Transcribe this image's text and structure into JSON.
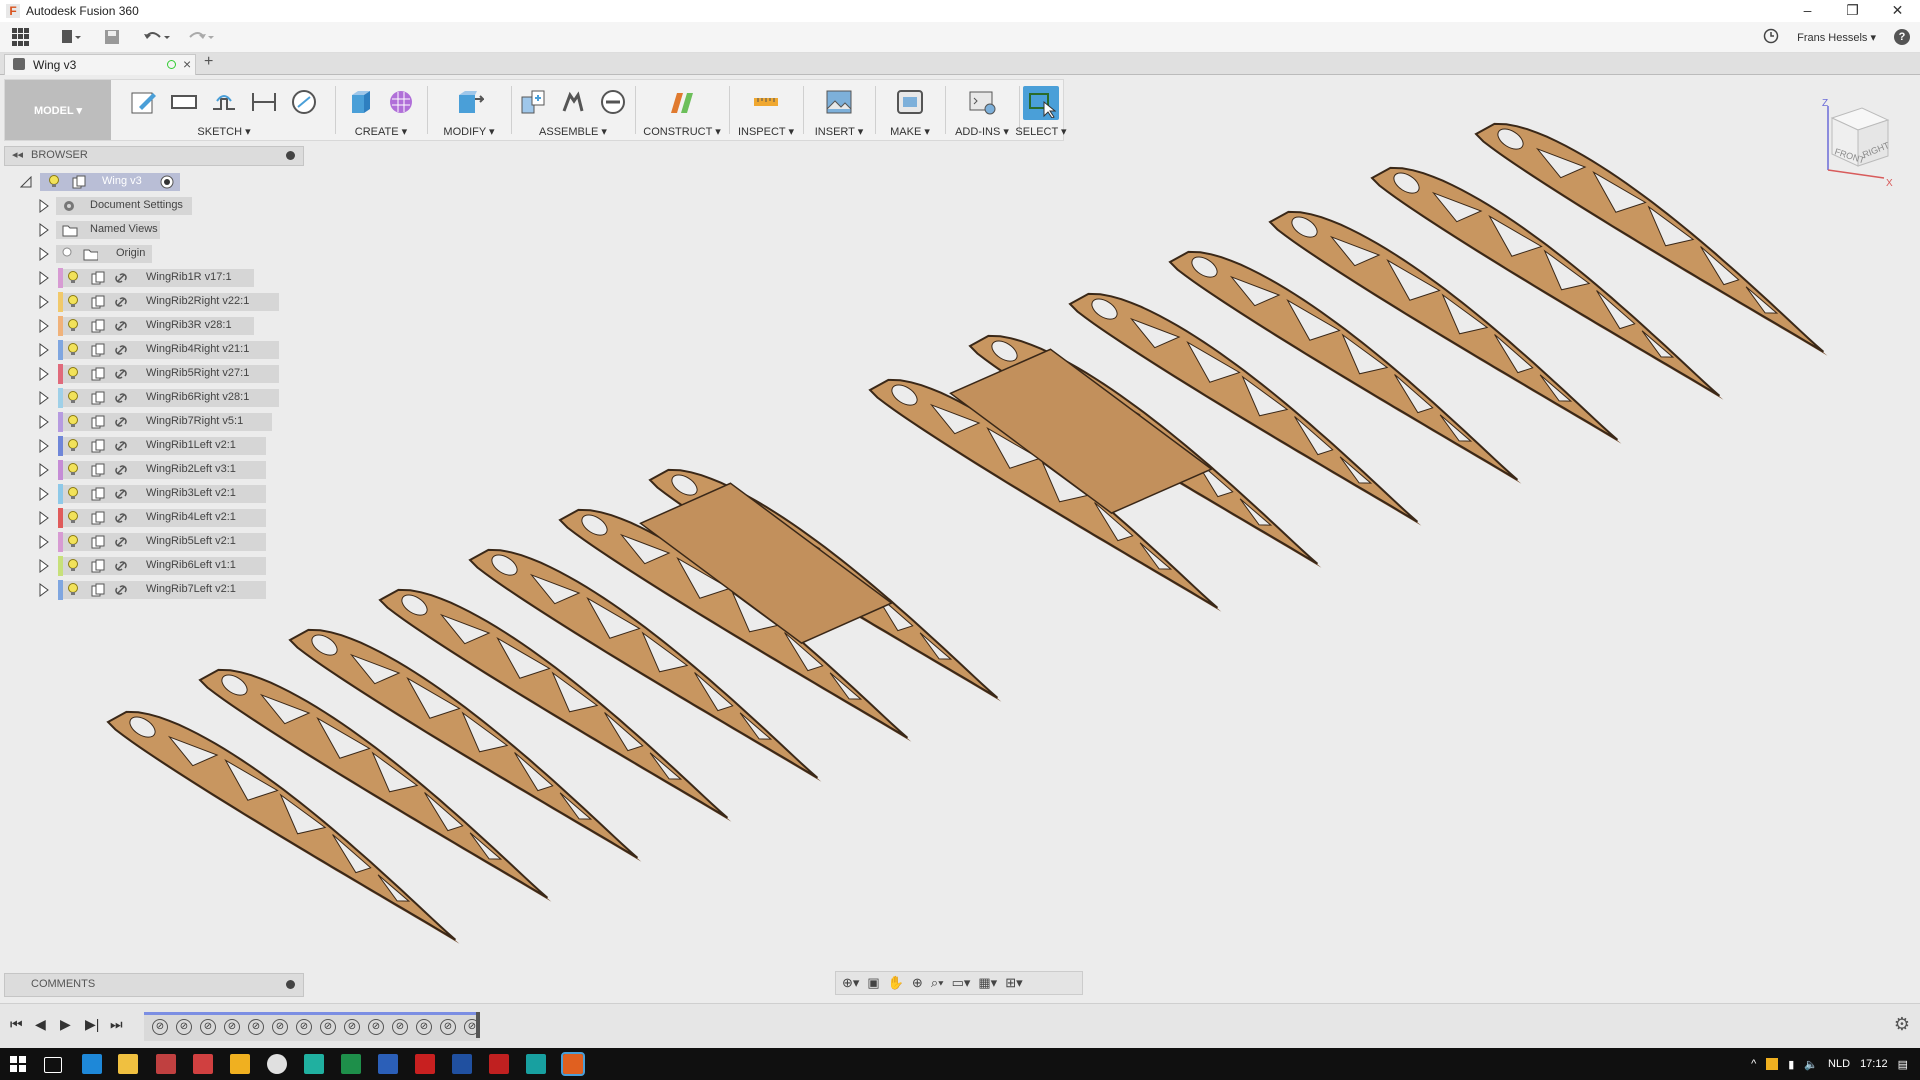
{
  "window": {
    "title": "Autodesk Fusion 360",
    "minimize": "–",
    "restore": "❐",
    "close": "✕"
  },
  "qat": {
    "user": "Frans Hessels",
    "help": "?"
  },
  "tab": {
    "name": "Wing v3",
    "new_tab": "+"
  },
  "workspace": {
    "label": "MODEL ▾"
  },
  "toolbar": {
    "groups": [
      {
        "label": "SKETCH ▾"
      },
      {
        "label": "CREATE ▾"
      },
      {
        "label": "MODIFY ▾"
      },
      {
        "label": "ASSEMBLE ▾"
      },
      {
        "label": "CONSTRUCT ▾"
      },
      {
        "label": "INSPECT ▾"
      },
      {
        "label": "INSERT ▾"
      },
      {
        "label": "MAKE ▾"
      },
      {
        "label": "ADD-INS ▾"
      },
      {
        "label": "SELECT ▾"
      }
    ]
  },
  "browser": {
    "title": "BROWSER",
    "root": "Wing v3",
    "items": [
      {
        "label": "Document Settings",
        "strip": ""
      },
      {
        "label": "Named Views",
        "strip": ""
      },
      {
        "label": "Origin",
        "strip": ""
      },
      {
        "label": "WingRib1R v17:1",
        "strip": "#d79bd3"
      },
      {
        "label": "WingRib2Right v22:1",
        "strip": "#f1c96b"
      },
      {
        "label": "WingRib3R v28:1",
        "strip": "#f0b27a"
      },
      {
        "label": "WingRib4Right v21:1",
        "strip": "#7fa6e0"
      },
      {
        "label": "WingRib5Right v27:1",
        "strip": "#e06a7b"
      },
      {
        "label": "WingRib6Right v28:1",
        "strip": "#9fd0e8"
      },
      {
        "label": "WingRib7Right v5:1",
        "strip": "#b69be0"
      },
      {
        "label": "WingRib1Left v2:1",
        "strip": "#6f86d8"
      },
      {
        "label": "WingRib2Left v3:1",
        "strip": "#c58cd6"
      },
      {
        "label": "WingRib3Left v2:1",
        "strip": "#8ec9e8"
      },
      {
        "label": "WingRib4Left v2:1",
        "strip": "#e05b5b"
      },
      {
        "label": "WingRib5Left v2:1",
        "strip": "#d79bd3"
      },
      {
        "label": "WingRib6Left v1:1",
        "strip": "#c7e07a"
      },
      {
        "label": "WingRib7Left v2:1",
        "strip": "#7fa6e0"
      }
    ]
  },
  "comments": {
    "title": "COMMENTS"
  },
  "viewcube": {
    "front": "FRONT",
    "right": "RIGHT",
    "z": "Z",
    "x": "X"
  },
  "taskbar": {
    "lang": "NLD",
    "time": "17:12"
  },
  "colors": {
    "accent": "#4a9fd8",
    "rib": "#c89660",
    "rib_dark": "#7a5233"
  }
}
